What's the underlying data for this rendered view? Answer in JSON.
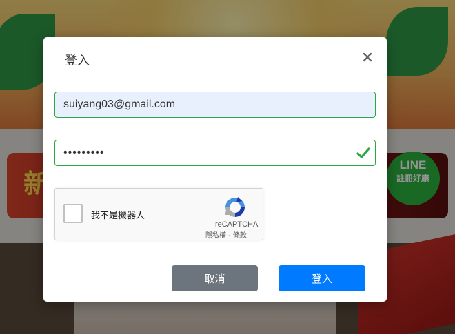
{
  "background": {
    "promo_text": "新",
    "line_badge": {
      "line1": "LINE",
      "line2": "註冊好康"
    }
  },
  "modal": {
    "title": "登入",
    "close_icon": "close-icon",
    "email": {
      "value": "suiyang03@gmail.com"
    },
    "password": {
      "masked_value": "•••••••••",
      "valid_icon": "check-icon"
    },
    "recaptcha": {
      "label": "我不是機器人",
      "brand": "reCAPTCHA",
      "terms": "隱私權 - 條款",
      "checked": false
    },
    "buttons": {
      "cancel": "取消",
      "login": "登入"
    }
  },
  "colors": {
    "valid_border": "#28a745",
    "cancel": "#6c757d",
    "primary": "#007bff",
    "autofill_bg": "#e8f0fe"
  }
}
